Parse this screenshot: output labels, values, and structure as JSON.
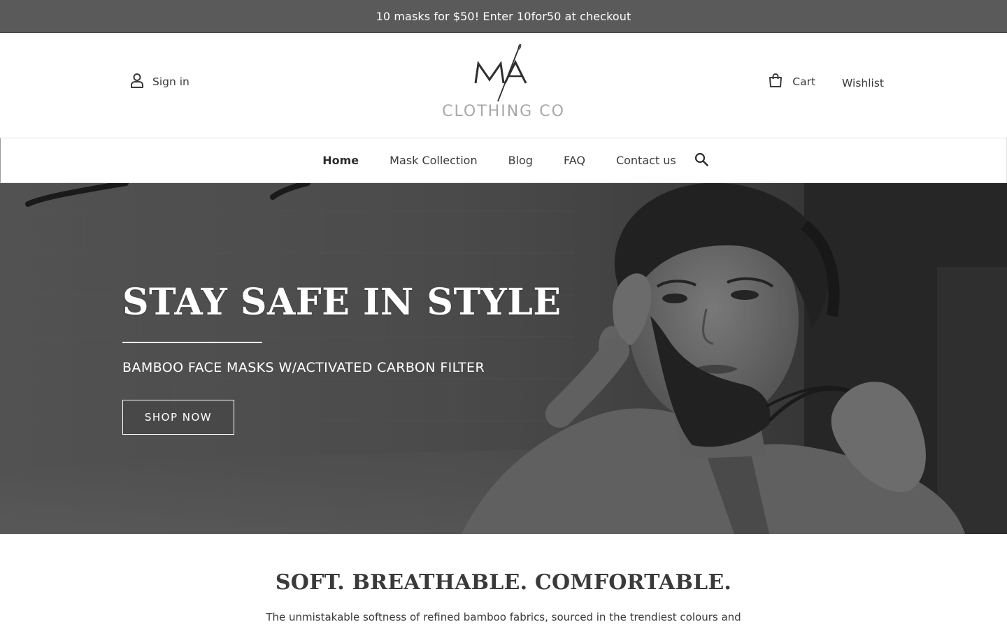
{
  "announcement": {
    "text": "10 masks for $50! Enter 10for50 at checkout"
  },
  "header": {
    "sign_in_label": "Sign in",
    "logo": {
      "monogram": "MA",
      "wordmark": "CLOTHING CO"
    },
    "cart_label": "Cart",
    "wishlist_label": "Wishlist"
  },
  "nav": {
    "items": [
      {
        "label": "Home",
        "active": true
      },
      {
        "label": "Mask Collection",
        "active": false
      },
      {
        "label": "Blog",
        "active": false
      },
      {
        "label": "FAQ",
        "active": false
      },
      {
        "label": "Contact us",
        "active": false
      }
    ],
    "search_icon": "search-icon"
  },
  "hero": {
    "title": "STAY SAFE IN STYLE",
    "subtitle": "BAMBOO FACE MASKS W/ACTIVATED CARBON FILTER",
    "button_label": "SHOP NOW"
  },
  "feature": {
    "heading": "SOFT. BREATHABLE. COMFORTABLE.",
    "text": "The unmistakable softness of refined bamboo fabrics, sourced in the trendiest colours and"
  },
  "icons": {
    "account": "person-icon",
    "cart": "shopping-bag-icon",
    "search": "search-icon"
  },
  "colors": {
    "announcement_bg": "#5a5a5a",
    "text": "#3a3a3a",
    "logo_wordmark": "#a8a8a8"
  }
}
